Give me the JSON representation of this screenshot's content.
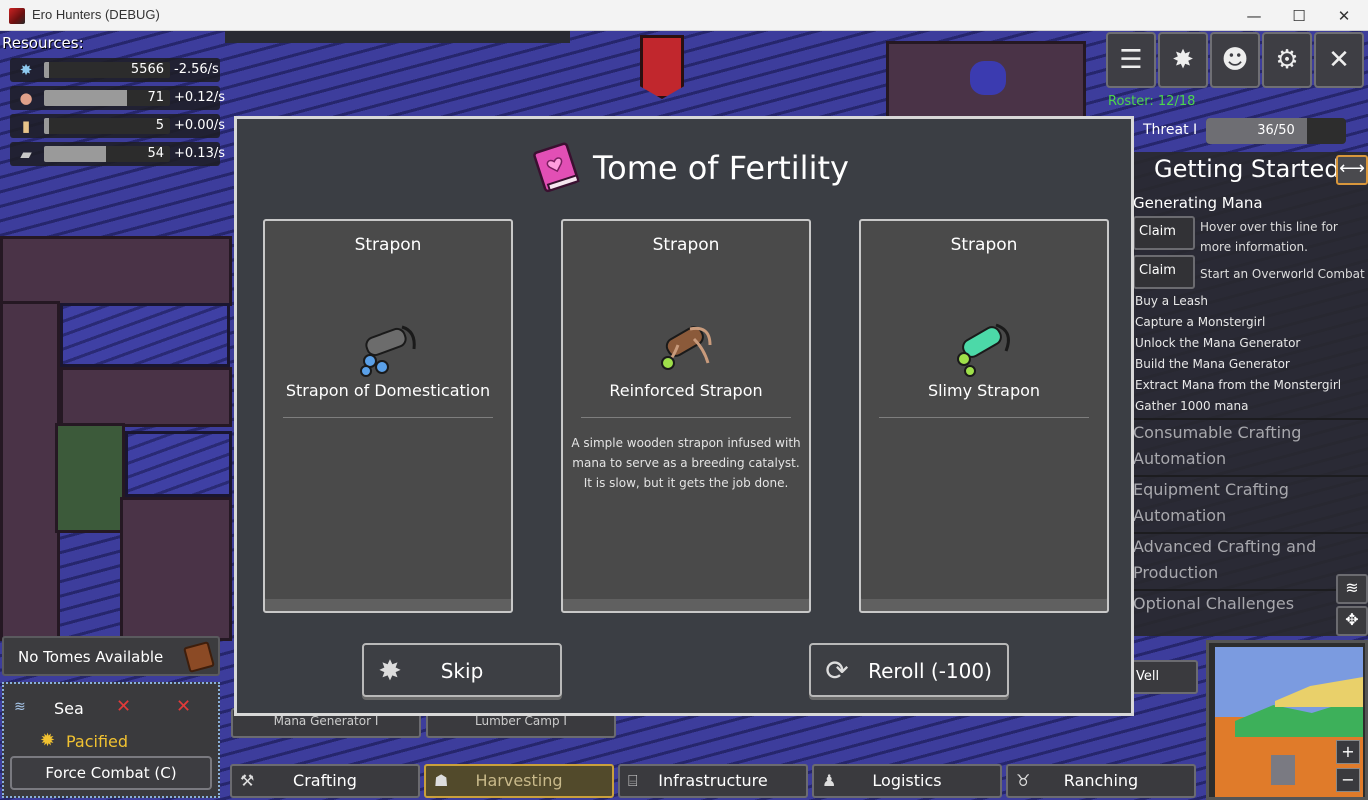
{
  "window": {
    "title": "Ero Hunters (DEBUG)",
    "minimize": "—",
    "maximize": "☐",
    "close": "✕"
  },
  "resources": {
    "title": "Resources:",
    "items": [
      {
        "icon": "mana-icon",
        "glyph": "✸",
        "value": "5566",
        "rate": "-2.56/s",
        "fill": 0.04,
        "color": "#8ec9ef"
      },
      {
        "icon": "meat-icon",
        "glyph": "●",
        "value": "71",
        "rate": "+0.12/s",
        "fill": 0.66,
        "color": "#e0a08a"
      },
      {
        "icon": "scroll-icon",
        "glyph": "▮",
        "value": "5",
        "rate": "+0.00/s",
        "fill": 0.04,
        "color": "#e8c48a"
      },
      {
        "icon": "lumber-icon",
        "glyph": "▰",
        "value": "54",
        "rate": "+0.13/s",
        "fill": 0.49,
        "color": "#c8c8c8"
      }
    ]
  },
  "topbar": {
    "buttons": [
      {
        "name": "list-icon",
        "glyph": "☰"
      },
      {
        "name": "mana-burst-icon",
        "glyph": "✸"
      },
      {
        "name": "monstergirl-portrait-icon",
        "glyph": "☻"
      },
      {
        "name": "gear-icon",
        "glyph": "⚙"
      },
      {
        "name": "close-icon",
        "glyph": "✕"
      }
    ],
    "roster": "Roster: 12/18",
    "threat_label": "Threat I",
    "threat_value": "36/50",
    "threat_fill": 0.72
  },
  "quests": {
    "title": "Getting Started",
    "collapse_glyph": "⟷",
    "subtitle": "Generating Mana",
    "claims": [
      {
        "label": "Claim",
        "desc": "Hover over this line for more information."
      },
      {
        "label": "Claim",
        "desc": "Start an Overworld Combat"
      }
    ],
    "items": [
      "Buy a Leash",
      "Capture a Monstergirl",
      "Unlock the Mana Generator",
      "Build the Mana Generator",
      "Extract Mana from the Monstergirl",
      "Gather 1000 mana"
    ],
    "sections": [
      "Consumable Crafting",
      "Automation",
      "Equipment Crafting",
      "Automation",
      "Advanced Crafting and",
      "Production",
      "Optional Challenges"
    ]
  },
  "dialog": {
    "title": "Tome of Fertility",
    "cards": [
      {
        "category": "Strapon",
        "name": "Strapon of Domestication",
        "desc": "",
        "tint": "#5aa0e8"
      },
      {
        "category": "Strapon",
        "name": "Reinforced Strapon",
        "desc": "A simple wooden strapon infused with mana to serve as a breeding catalyst. It is slow, but it gets the job done.",
        "tint": "#8b5a3a"
      },
      {
        "category": "Strapon",
        "name": "Slimy Strapon",
        "desc": "",
        "tint": "#4cd9a8"
      }
    ],
    "skip_label": "Skip",
    "reroll_label": "Reroll (-100)"
  },
  "left_panel": {
    "tomes_label": "No Tomes Available",
    "region_name": "Sea",
    "region_status": "Pacified",
    "force_combat": "Force Combat (C)"
  },
  "bottom_tabs": [
    {
      "label": "Crafting",
      "icon": "hammer-icon",
      "glyph": "⚒"
    },
    {
      "label": "Harvesting",
      "icon": "basket-icon",
      "glyph": "☗",
      "active": true
    },
    {
      "label": "Infrastructure",
      "icon": "gate-icon",
      "glyph": "⌸"
    },
    {
      "label": "Logistics",
      "icon": "worker-icon",
      "glyph": "♟"
    },
    {
      "label": "Ranching",
      "icon": "cow-icon",
      "glyph": "♉"
    }
  ],
  "sub_tabs": [
    "Mana Generator I",
    "Lumber Camp I"
  ],
  "well_label": "Vell"
}
